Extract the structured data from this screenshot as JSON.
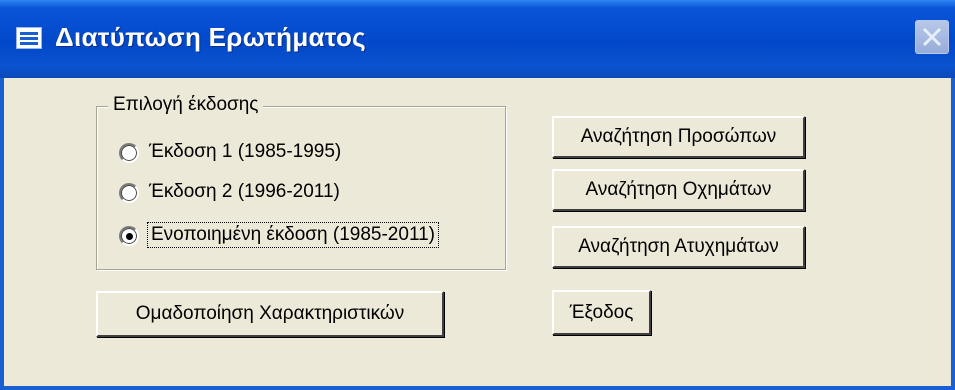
{
  "window": {
    "title": "Διατύπωση Ερωτήματος",
    "icon": "form-icon",
    "close_icon": "close-icon"
  },
  "edition_group": {
    "label": "Επιλογή έκδοσης",
    "options": [
      {
        "label": "Έκδοση 1 (1985-1995)",
        "selected": false
      },
      {
        "label": "Έκδοση 2 (1996-2011)",
        "selected": false
      },
      {
        "label": "Ενοποιημένη έκδοση (1985-2011)",
        "selected": true
      }
    ]
  },
  "buttons": {
    "search_persons": "Αναζήτηση Προσώπων",
    "search_vehicles": "Αναζήτηση Οχημάτων",
    "search_accidents": "Αναζήτηση Ατυχημάτων",
    "group_characteristics": "Ομαδοποίηση Χαρακτηριστικών",
    "exit": "Έξοδος"
  },
  "colors": {
    "titlebar": "#0248c9",
    "dialog_bg": "#ece9d8",
    "close_button": "#a9bbe4"
  }
}
